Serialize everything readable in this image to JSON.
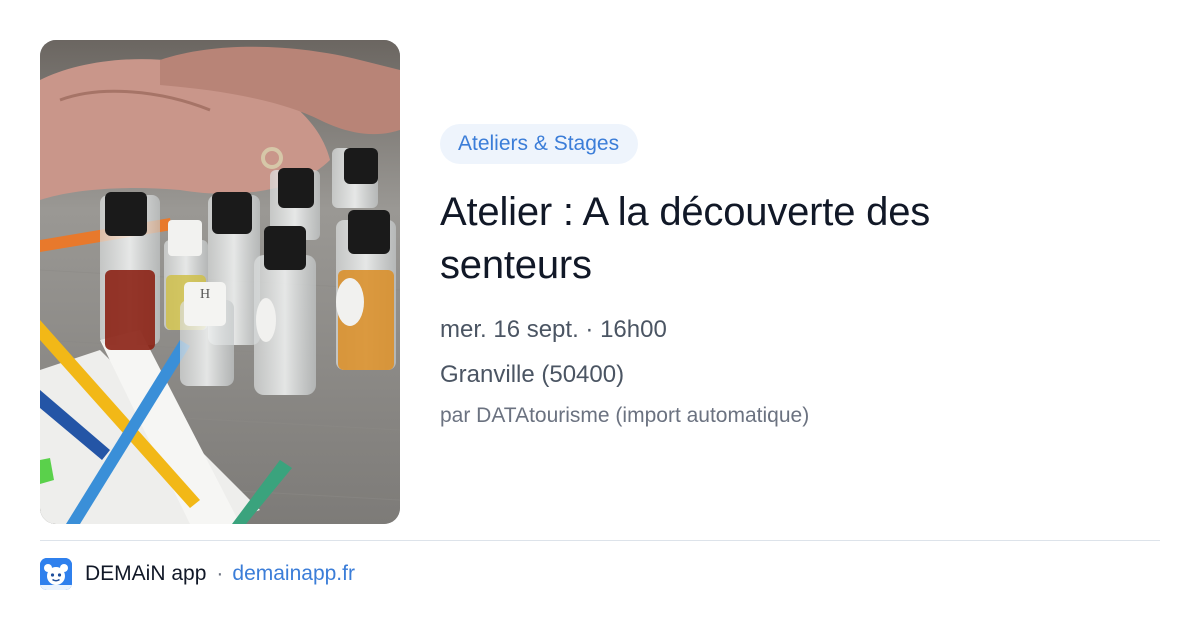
{
  "event": {
    "category": "Ateliers & Stages",
    "title": "Atelier : A la découverte des senteurs",
    "datetime": "mer. 16 sept. · 16h00",
    "location": "Granville (50400)",
    "source": "par DATAtourisme (import automatique)"
  },
  "image": {
    "subject": "perfume-bottles-workshop-photo",
    "vial_label": "H"
  },
  "footer": {
    "app_name": "DEMAiN app",
    "separator": "·",
    "domain": "demainapp.fr",
    "logo_icon": "demain-app-logo-icon"
  },
  "colors": {
    "accent": "#3b7dd8",
    "category_bg": "#eef4fc",
    "title": "#111827",
    "meta": "#4b5563",
    "source": "#6b7280",
    "logo_bg": "#2f80ed"
  }
}
